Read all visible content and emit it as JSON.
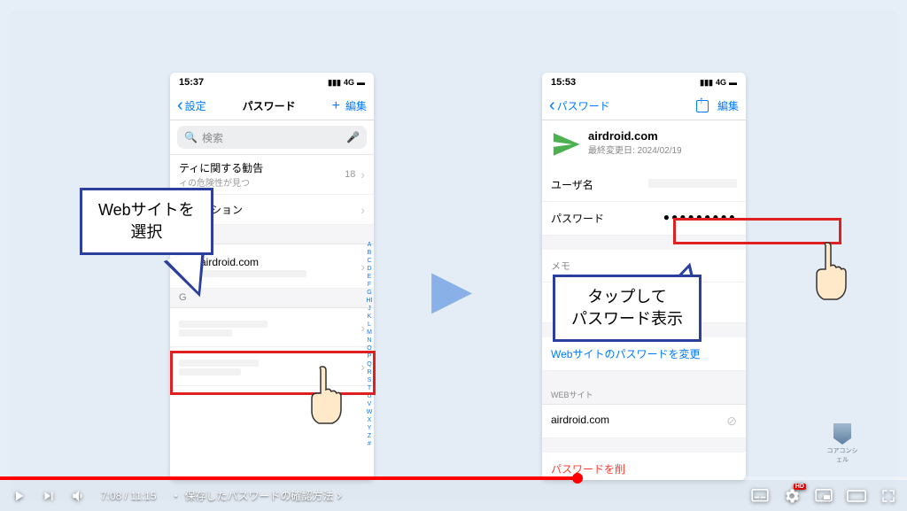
{
  "phone_left": {
    "time": "15:37",
    "signal": "4G",
    "back": "設定",
    "title": "パスワード",
    "add": "+",
    "edit": "編集",
    "search_placeholder": "検索",
    "security_title": "ティに関する勧告",
    "security_sub": "ィの危険性が見つ",
    "security_count": "18",
    "option_title": "ドオプション",
    "index_a": "A",
    "site": "airdroid.com",
    "index_g": "G",
    "alpha": "ABCDEFGHIJKLMNOPQRSTUVWXYZ#"
  },
  "phone_right": {
    "time": "15:53",
    "signal": "4G",
    "back": "パスワード",
    "edit": "編集",
    "site_title": "airdroid.com",
    "site_sub": "最終変更日: 2024/02/19",
    "user_label": "ユーザ名",
    "pass_label": "パスワード",
    "pass_value": "●●●●●●●●●",
    "memo_label": "メモ",
    "change_link": "Webサイトのパスワードを変更",
    "web_label": "WEBサイト",
    "web_value": "airdroid.com",
    "delete": "パスワードを削"
  },
  "callouts": {
    "left_l1": "Webサイトを",
    "left_l2": "選択",
    "right_l1": "タップして",
    "right_l2": "パスワード表示"
  },
  "player": {
    "current": "7:08",
    "sep": " / ",
    "total": "11:15",
    "dot": "・",
    "chapter": "保存したパスワードの確認方法",
    "hd": "HD"
  },
  "channel": "コアコンシェル"
}
